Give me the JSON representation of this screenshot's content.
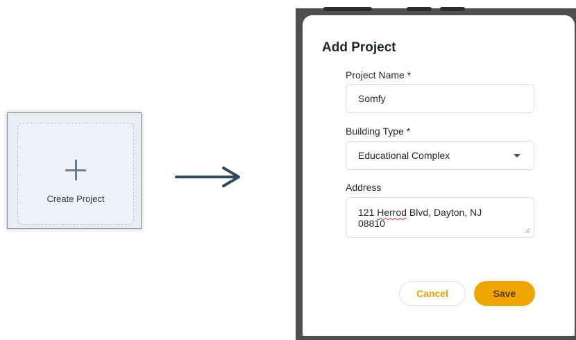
{
  "create_card": {
    "label": "Create Project",
    "icon": "plus-icon"
  },
  "arrow": {
    "icon": "arrow-right-icon",
    "color": "#2f4a5e"
  },
  "modal": {
    "title": "Add Project",
    "fields": {
      "project_name": {
        "label": "Project Name *",
        "value": "Somfy"
      },
      "building_type": {
        "label": "Building Type *",
        "value": "Educational Complex",
        "icon": "chevron-down-icon"
      },
      "address": {
        "label": "Address",
        "value_pre": "121 ",
        "value_misspelled": "Herrod",
        "value_post": " Blvd, Dayton, NJ",
        "value_line2": "08810"
      }
    },
    "buttons": {
      "cancel": "Cancel",
      "save": "Save"
    }
  },
  "colors": {
    "accent": "#eea500",
    "overlay": "#4f4f4f",
    "card_bg": "#eef1f7"
  }
}
